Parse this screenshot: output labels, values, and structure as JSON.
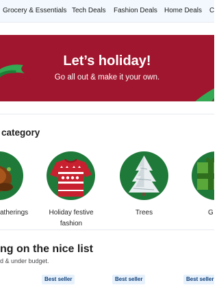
{
  "nav": {
    "items": [
      {
        "label": "Grocery & Essentials"
      },
      {
        "label": "Tech Deals"
      },
      {
        "label": "Fashion Deals"
      },
      {
        "label": "Home Deals"
      },
      {
        "label": "C"
      }
    ]
  },
  "banner": {
    "title": "Let’s holiday!",
    "subtitle": "Go all out & make it your own.",
    "bg_color": "#a0162e",
    "ribbon_color": "#34a853"
  },
  "categories": {
    "title": "category",
    "items": [
      {
        "label": "atherings",
        "icon": "turkey-icon"
      },
      {
        "label": "Holiday festive",
        "label2": "fashion",
        "icon": "festive-sweater-icon"
      },
      {
        "label": "Trees",
        "icon": "christmas-tree-icon"
      },
      {
        "label": "G",
        "icon": "gift-icon"
      }
    ]
  },
  "nice_list": {
    "title": "ng on the nice list",
    "subtitle": "d & under budget."
  },
  "badges": [
    {
      "label": "Best seller"
    },
    {
      "label": "Best seller"
    },
    {
      "label": "Best seller"
    }
  ],
  "colors": {
    "nav_bg": "#f2f8fd",
    "circle_green": "#1f7a3a",
    "badge_bg": "#e6f1fc",
    "badge_text": "#0d3d78"
  }
}
